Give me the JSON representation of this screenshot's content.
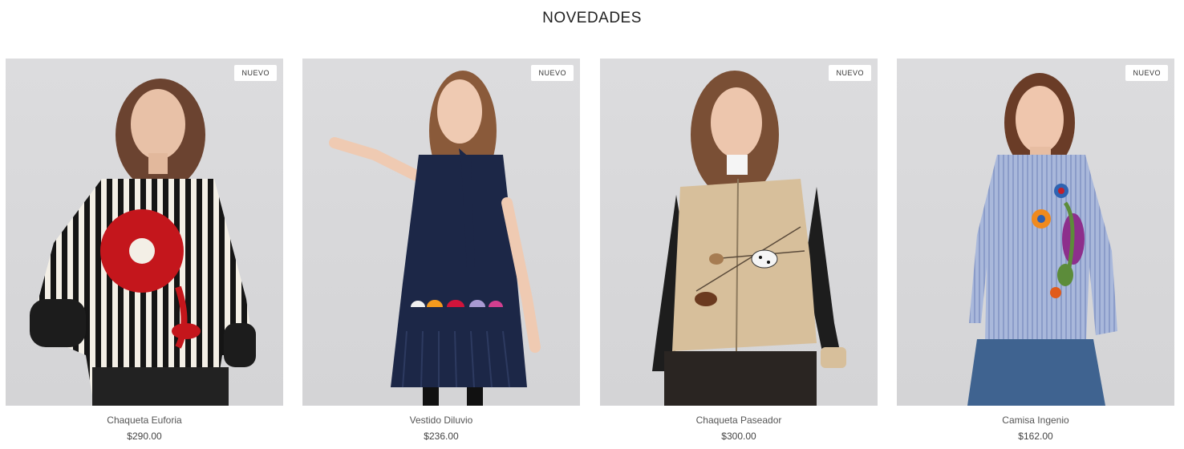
{
  "section": {
    "title": "NOVEDADES"
  },
  "products": [
    {
      "name": "Chaqueta Euforia",
      "price": "$290.00",
      "badge": "NUEVO",
      "image": "model-striped-jacket-red-flower"
    },
    {
      "name": "Vestido Diluvio",
      "price": "$236.00",
      "badge": "NUEVO",
      "image": "model-navy-dress-umbrellas"
    },
    {
      "name": "Chaqueta Paseador",
      "price": "$300.00",
      "badge": "NUEVO",
      "image": "model-beige-jacket-dogs"
    },
    {
      "name": "Camisa Ingenio",
      "price": "$162.00",
      "badge": "NUEVO",
      "image": "model-blue-striped-shirt-flowers"
    }
  ]
}
